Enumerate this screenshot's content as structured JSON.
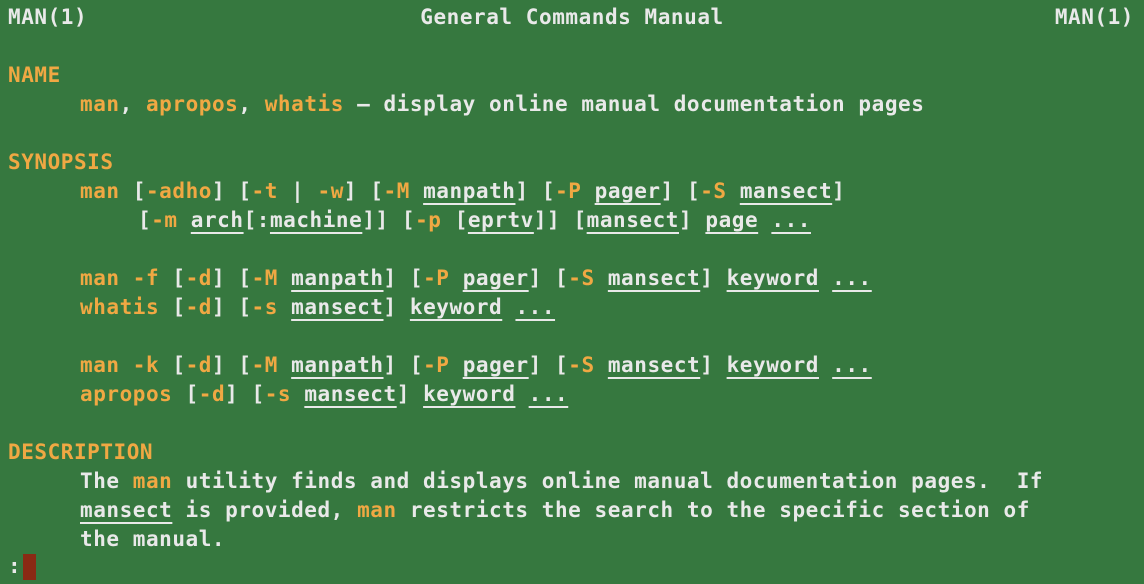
{
  "header": {
    "left": "MAN(1)",
    "center": "General Commands Manual",
    "right": "MAN(1)"
  },
  "sections": {
    "name": "NAME",
    "synopsis": "SYNOPSIS",
    "description": "DESCRIPTION"
  },
  "name_line": {
    "cmd1": "man",
    "sep1": ", ",
    "cmd2": "apropos",
    "sep2": ", ",
    "cmd3": "whatis",
    "summary": " — display online manual documentation pages"
  },
  "words": {
    "man": "man",
    "whatis": "whatis",
    "apropos": "apropos",
    "manpath": "manpath",
    "pager": "pager",
    "mansect": "mansect",
    "keyword": "keyword",
    "ellipsis": "...",
    "arch": "arch",
    "machine": "machine",
    "eprtv": "eprtv",
    "page": "page"
  },
  "flags": {
    "adho": "-adho",
    "t": "-t",
    "w": "-w",
    "M": "-M",
    "P": "-P",
    "S": "-S",
    "m": "-m",
    "p": "-p",
    "f": "-f",
    "d": "-d",
    "s": "-s",
    "k": "-k"
  },
  "description": {
    "l1_a": "The ",
    "l1_b": "man",
    "l1_c": " utility finds and displays online manual documentation pages.  If",
    "l2_a": "mansect",
    "l2_b": " is provided, ",
    "l2_c": "man",
    "l2_d": " restricts the search to the specific section of",
    "l3": "the manual."
  },
  "prompt": {
    "symbol": ":"
  }
}
